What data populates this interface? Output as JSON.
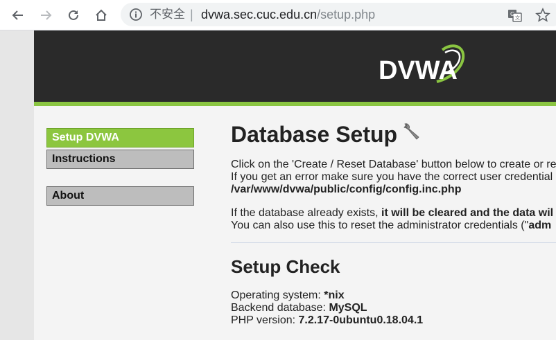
{
  "browser": {
    "security_label": "不安全",
    "separator": "|",
    "url_host": "dvwa.sec.cuc.edu.cn",
    "url_path": "/setup.php"
  },
  "header": {
    "logo_text": "DVWA",
    "accent_color": "#8ac541"
  },
  "menu": {
    "items": [
      {
        "label": "Setup DVWA",
        "selected": true
      },
      {
        "label": "Instructions",
        "selected": false
      },
      {
        "label": "About",
        "selected": false
      }
    ]
  },
  "main": {
    "title": "Database Setup",
    "intro_line1": "Click on the 'Create / Reset Database' button below to create or re",
    "intro_line2": "If you get an error make sure you have the correct user credential",
    "config_path": "/var/www/dvwa/public/config/config.inc.php",
    "warn_prefix": "If the database already exists, ",
    "warn_bold": "it will be cleared and the data wil",
    "reset_prefix": "You can also use this to reset the administrator credentials (\"",
    "reset_bold": "adm",
    "setup_check_title": "Setup Check",
    "os_label": "Operating system: ",
    "os_value": "*nix",
    "db_label": "Backend database: ",
    "db_value": "MySQL",
    "php_label": "PHP version: ",
    "php_value": "7.2.17-0ubuntu0.18.04.1"
  }
}
